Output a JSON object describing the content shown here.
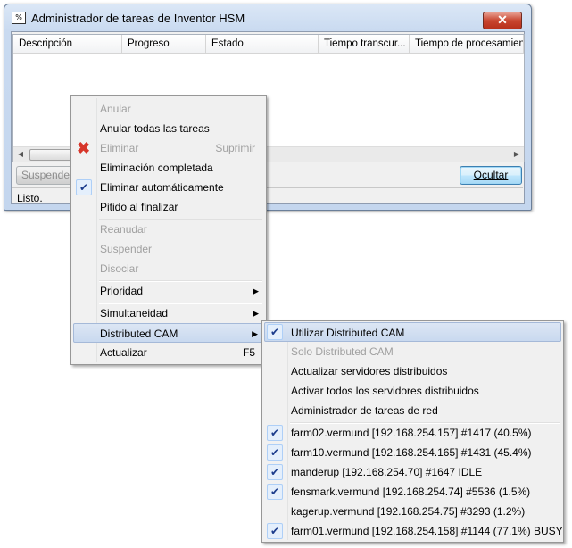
{
  "window": {
    "icon": "%",
    "title": "Administrador de tareas de Inventor HSM",
    "close_glyph": "✕"
  },
  "list": {
    "columns": [
      "Descripción",
      "Progreso",
      "Estado",
      "Tiempo transcur...",
      "Tiempo de procesamiento"
    ]
  },
  "buttons": {
    "suspend": "Suspender",
    "hide": "Ocultar"
  },
  "status_text": "Listo.",
  "context_menu": {
    "items": [
      {
        "label": "Anular"
      },
      {
        "label": "Anular todas las tareas"
      },
      {
        "label": "Eliminar",
        "shortcut": "Suprimir"
      },
      {
        "label": "Eliminación completada"
      },
      {
        "label": "Eliminar automáticamente"
      },
      {
        "label": "Pitido al finalizar"
      },
      {
        "label": "Reanudar"
      },
      {
        "label": "Suspender"
      },
      {
        "label": "Disociar"
      },
      {
        "label": "Prioridad"
      },
      {
        "label": "Simultaneidad"
      },
      {
        "label": "Distributed CAM"
      },
      {
        "label": "Actualizar",
        "shortcut": "F5"
      }
    ],
    "submenu_arrow": "▶",
    "check_glyph": "✔",
    "delete_glyph": "✖"
  },
  "submenu": {
    "items": [
      {
        "label": "Utilizar Distributed CAM"
      },
      {
        "label": "Solo Distributed CAM"
      },
      {
        "label": "Actualizar servidores distribuidos"
      },
      {
        "label": "Activar todos los servidores distribuidos"
      },
      {
        "label": "Administrador de tareas de red"
      },
      {
        "label": "farm02.vermund [192.168.254.157] #1417 (40.5%)"
      },
      {
        "label": "farm10.vermund [192.168.254.165] #1431 (45.4%)"
      },
      {
        "label": "manderup [192.168.254.70] #1647 IDLE"
      },
      {
        "label": "fensmark.vermund [192.168.254.74] #5536 (1.5%)"
      },
      {
        "label": "kagerup.vermund [192.168.254.75] #3293 (1.2%)"
      },
      {
        "label": "farm01.vermund [192.168.254.158] #1144 (77.1%) BUSY"
      }
    ]
  }
}
